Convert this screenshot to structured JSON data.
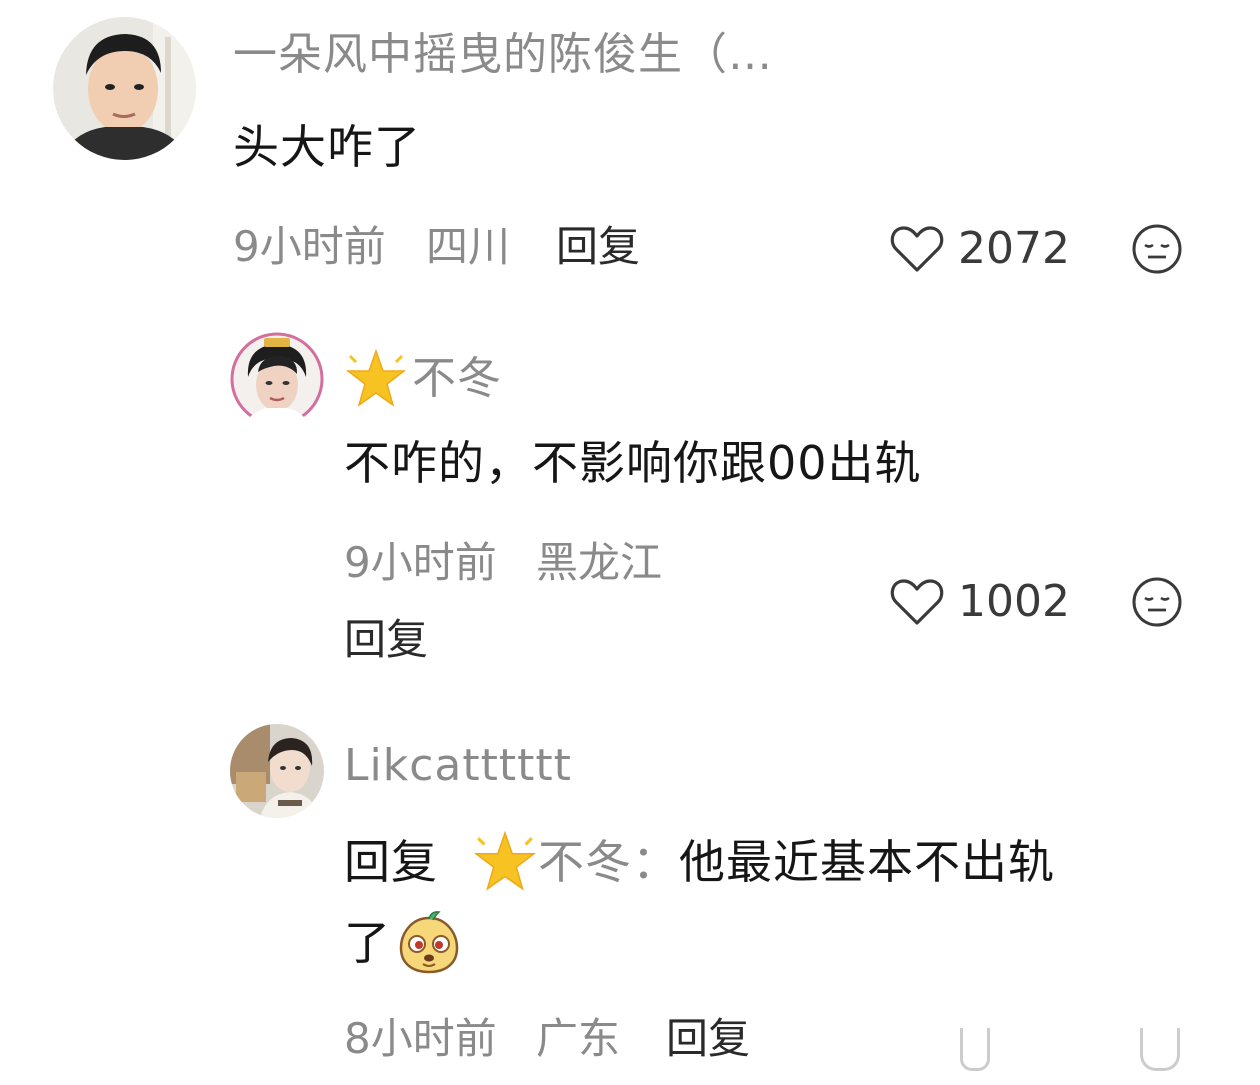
{
  "comments": [
    {
      "username": "一朵风中摇曳的陈俊生（…",
      "text": "头大咋了",
      "time": "9小时前",
      "location": "四川",
      "reply_label": "回复",
      "likes": "2072",
      "avatar": "male-portrait"
    },
    {
      "username": "不冬",
      "username_icon": "star-icon",
      "text": "不咋的，不影响你跟00出轨",
      "time": "9小时前",
      "location": "黑龙江",
      "reply_label": "回复",
      "likes": "1002",
      "avatar": "female-portrait"
    },
    {
      "username": "Likcatttttt",
      "reply_prefix": "回复",
      "mention": "不冬：",
      "text_line1": "他最近基本不出轨",
      "text_line2": "了",
      "time": "8小时前",
      "location": "广东",
      "reply_label": "回复",
      "avatar": "girl-portrait",
      "emoji": "cartoon-dog-emoji"
    }
  ],
  "colors": {
    "background": "#ffffff",
    "username": "#8a8a8a",
    "text": "#161616",
    "meta": "#8a8a8a",
    "star": "#f7c322"
  }
}
